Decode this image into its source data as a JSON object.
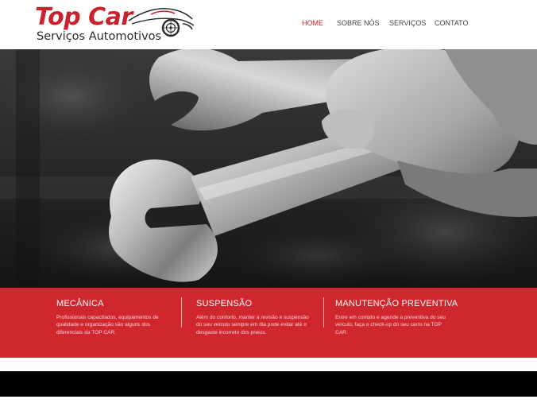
{
  "brand": {
    "title": "Top Car",
    "subtitle": "Serviços Automotivos",
    "title_color": "#c8232c"
  },
  "nav": {
    "items": [
      "HOME",
      "SOBRE NÓS",
      "SERVIÇOS",
      "CONTATO"
    ],
    "active": "HOME",
    "active_color": "#c8232c"
  },
  "hero": {
    "image": "wrench-in-hand-photo"
  },
  "services": [
    {
      "title": "MECÂNICA",
      "text": "Profissionais capacitados, equipamentos de qualidade e organização são alguns dos diferenciais da TOP CAR."
    },
    {
      "title": "SUSPENSÃO",
      "text": "Além do conforto, manter a revisão e suspensão do seu veículo sempre em dia pode evitar até o desgaste incorreto dos pneus."
    },
    {
      "title": "MANUTENÇÃO PREVENTIVA",
      "text": "Entre em contato e agende a preventiva do seu veículo, faça  o check-up do seu carro na TOP CAR."
    }
  ],
  "colors": {
    "band": "#d0262e",
    "footer": "#000000"
  }
}
